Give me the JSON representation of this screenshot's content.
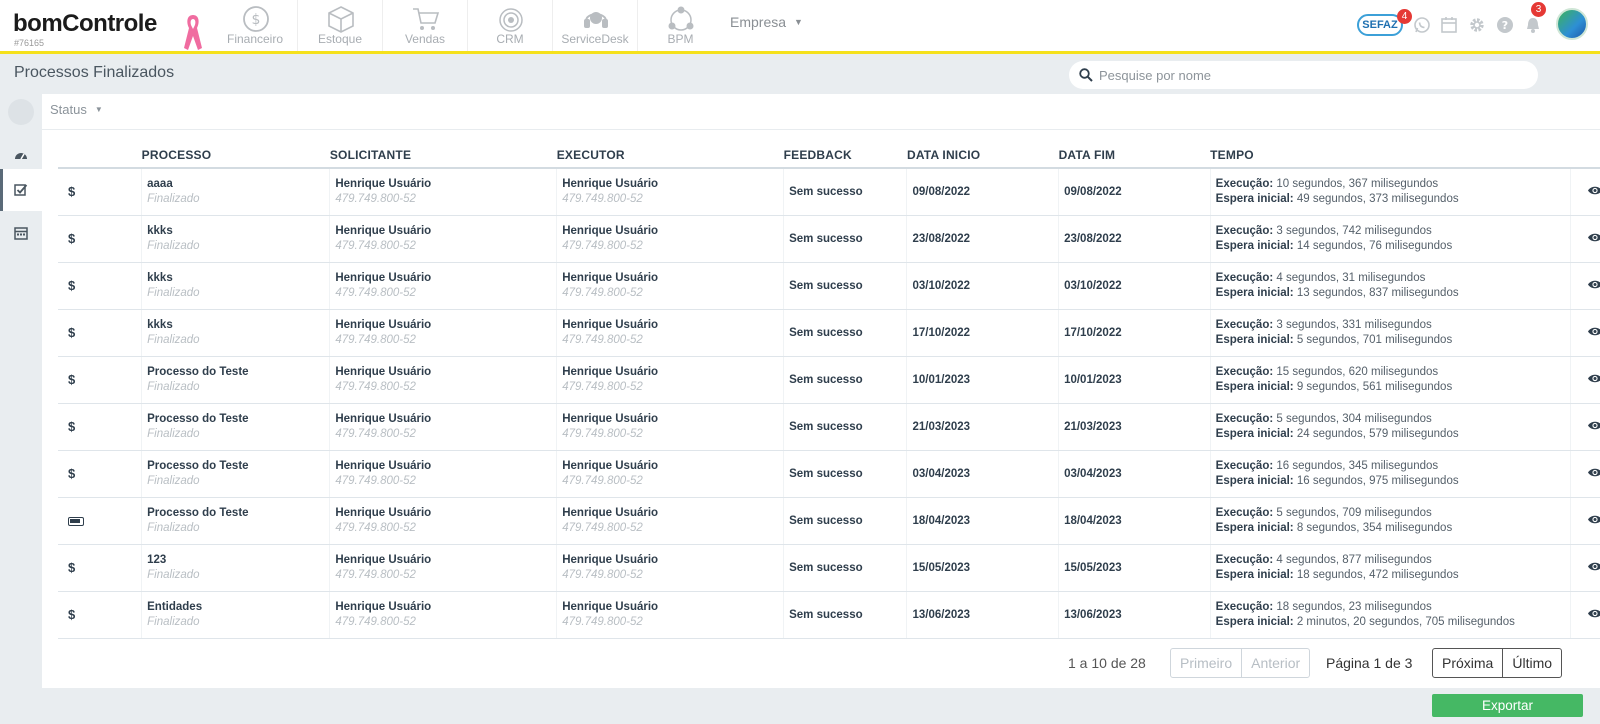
{
  "app": {
    "logo_text": "bomControle",
    "account_id": "#76165",
    "modules": [
      {
        "label": "Financeiro",
        "icon": "coin-icon"
      },
      {
        "label": "Estoque",
        "icon": "box-icon"
      },
      {
        "label": "Vendas",
        "icon": "cart-icon"
      },
      {
        "label": "CRM",
        "icon": "target-icon"
      },
      {
        "label": "ServiceDesk",
        "icon": "headset-icon"
      },
      {
        "label": "BPM",
        "icon": "workflow-icon"
      }
    ],
    "empresa_label": "Empresa",
    "sefaz_label": "SEFAZ",
    "sefaz_badge": "4",
    "notifications_badge": "3"
  },
  "page": {
    "title": "Processos Finalizados",
    "search_placeholder": "Pesquise por nome",
    "status_filter": "Status"
  },
  "table": {
    "headers": [
      "PROCESSO",
      "SOLICITANTE",
      "EXECUTOR",
      "FEEDBACK",
      "DATA INICIO",
      "DATA FIM",
      "TEMPO"
    ],
    "exec_label": "Execução:",
    "wait_label": "Espera inicial:",
    "rows": [
      {
        "icon": "$",
        "process": "aaaa",
        "status": "Finalizado",
        "requester": "Henrique Usuário",
        "requester_doc": "479.749.800-52",
        "executor": "Henrique Usuário",
        "executor_doc": "479.749.800-52",
        "feedback": "Sem sucesso",
        "start": "09/08/2022",
        "end": "09/08/2022",
        "exec": "10 segundos, 367 milisegundos",
        "wait": "49 segundos, 373 milisegundos"
      },
      {
        "icon": "$",
        "process": "kkks",
        "status": "Finalizado",
        "requester": "Henrique Usuário",
        "requester_doc": "479.749.800-52",
        "executor": "Henrique Usuário",
        "executor_doc": "479.749.800-52",
        "feedback": "Sem sucesso",
        "start": "23/08/2022",
        "end": "23/08/2022",
        "exec": "3 segundos, 742 milisegundos",
        "wait": "14 segundos, 76 milisegundos"
      },
      {
        "icon": "$",
        "process": "kkks",
        "status": "Finalizado",
        "requester": "Henrique Usuário",
        "requester_doc": "479.749.800-52",
        "executor": "Henrique Usuário",
        "executor_doc": "479.749.800-52",
        "feedback": "Sem sucesso",
        "start": "03/10/2022",
        "end": "03/10/2022",
        "exec": "4 segundos, 31 milisegundos",
        "wait": "13 segundos, 837 milisegundos"
      },
      {
        "icon": "$",
        "process": "kkks",
        "status": "Finalizado",
        "requester": "Henrique Usuário",
        "requester_doc": "479.749.800-52",
        "executor": "Henrique Usuário",
        "executor_doc": "479.749.800-52",
        "feedback": "Sem sucesso",
        "start": "17/10/2022",
        "end": "17/10/2022",
        "exec": "3 segundos, 331 milisegundos",
        "wait": "5 segundos, 701 milisegundos"
      },
      {
        "icon": "$",
        "process": "Processo do Teste",
        "status": "Finalizado",
        "requester": "Henrique Usuário",
        "requester_doc": "479.749.800-52",
        "executor": "Henrique Usuário",
        "executor_doc": "479.749.800-52",
        "feedback": "Sem sucesso",
        "start": "10/01/2023",
        "end": "10/01/2023",
        "exec": "15 segundos, 620 milisegundos",
        "wait": "9 segundos, 561 milisegundos"
      },
      {
        "icon": "$",
        "process": "Processo do Teste",
        "status": "Finalizado",
        "requester": "Henrique Usuário",
        "requester_doc": "479.749.800-52",
        "executor": "Henrique Usuário",
        "executor_doc": "479.749.800-52",
        "feedback": "Sem sucesso",
        "start": "21/03/2023",
        "end": "21/03/2023",
        "exec": "5 segundos, 304 milisegundos",
        "wait": "24 segundos, 579 milisegundos"
      },
      {
        "icon": "$",
        "process": "Processo do Teste",
        "status": "Finalizado",
        "requester": "Henrique Usuário",
        "requester_doc": "479.749.800-52",
        "executor": "Henrique Usuário",
        "executor_doc": "479.749.800-52",
        "feedback": "Sem sucesso",
        "start": "03/04/2023",
        "end": "03/04/2023",
        "exec": "16 segundos, 345 milisegundos",
        "wait": "16 segundos, 975 milisegundos"
      },
      {
        "icon": "battery",
        "process": "Processo do Teste",
        "status": "Finalizado",
        "requester": "Henrique Usuário",
        "requester_doc": "479.749.800-52",
        "executor": "Henrique Usuário",
        "executor_doc": "479.749.800-52",
        "feedback": "Sem sucesso",
        "start": "18/04/2023",
        "end": "18/04/2023",
        "exec": "5 segundos, 709 milisegundos",
        "wait": "8 segundos, 354 milisegundos"
      },
      {
        "icon": "$",
        "process": "123",
        "status": "Finalizado",
        "requester": "Henrique Usuário",
        "requester_doc": "479.749.800-52",
        "executor": "Henrique Usuário",
        "executor_doc": "479.749.800-52",
        "feedback": "Sem sucesso",
        "start": "15/05/2023",
        "end": "15/05/2023",
        "exec": "4 segundos, 877 milisegundos",
        "wait": "18 segundos, 472 milisegundos"
      },
      {
        "icon": "$",
        "process": "Entidades",
        "status": "Finalizado",
        "requester": "Henrique Usuário",
        "requester_doc": "479.749.800-52",
        "executor": "Henrique Usuário",
        "executor_doc": "479.749.800-52",
        "feedback": "Sem sucesso",
        "start": "13/06/2023",
        "end": "13/06/2023",
        "exec": "18 segundos, 23 milisegundos",
        "wait": "2 minutos, 20 segundos, 705 milisegundos"
      }
    ]
  },
  "pagination": {
    "range": "1 a 10 de 28",
    "first": "Primeiro",
    "prev": "Anterior",
    "page": "Página 1 de 3",
    "next": "Próxima",
    "last": "Último"
  },
  "actions": {
    "export": "Exportar"
  },
  "colors": {
    "accent_yellow": "#f5e11b",
    "export_green": "#45b864",
    "badge_red": "#e53935"
  }
}
